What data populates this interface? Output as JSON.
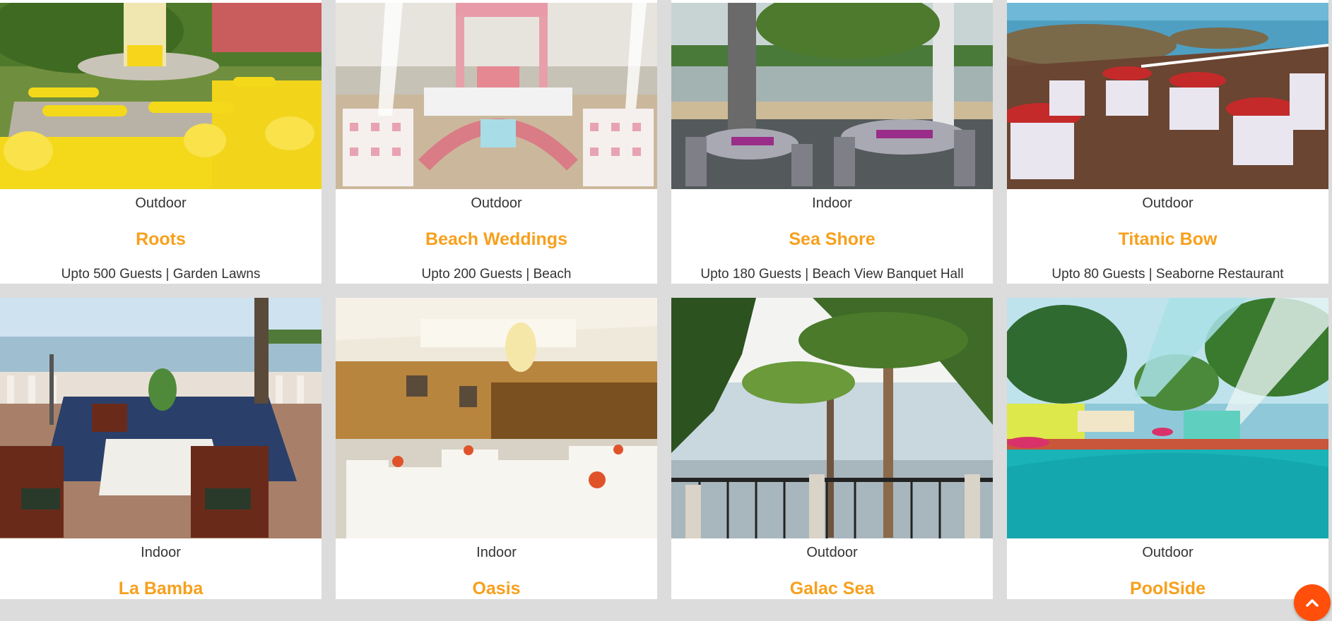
{
  "venues_row1": [
    {
      "type": "Outdoor",
      "title": "Roots",
      "desc": "Upto 500 Guests | Garden Lawns"
    },
    {
      "type": "Outdoor",
      "title": "Beach Weddings",
      "desc": "Upto 200 Guests | Beach"
    },
    {
      "type": "Indoor",
      "title": "Sea Shore",
      "desc": "Upto 180 Guests | Beach View Banquet Hall"
    },
    {
      "type": "Outdoor",
      "title": "Titanic Bow",
      "desc": "Upto 80 Guests | Seaborne Restaurant"
    }
  ],
  "venues_row2": [
    {
      "type": "Indoor",
      "title": "La Bamba"
    },
    {
      "type": "Indoor",
      "title": "Oasis"
    },
    {
      "type": "Outdoor",
      "title": "Galac Sea"
    },
    {
      "type": "Outdoor",
      "title": "PoolSide"
    }
  ],
  "colors": {
    "accent": "#f7a01c",
    "fab": "#ff4f0a"
  },
  "icons": {
    "scroll_top": "chevron-up-icon"
  }
}
